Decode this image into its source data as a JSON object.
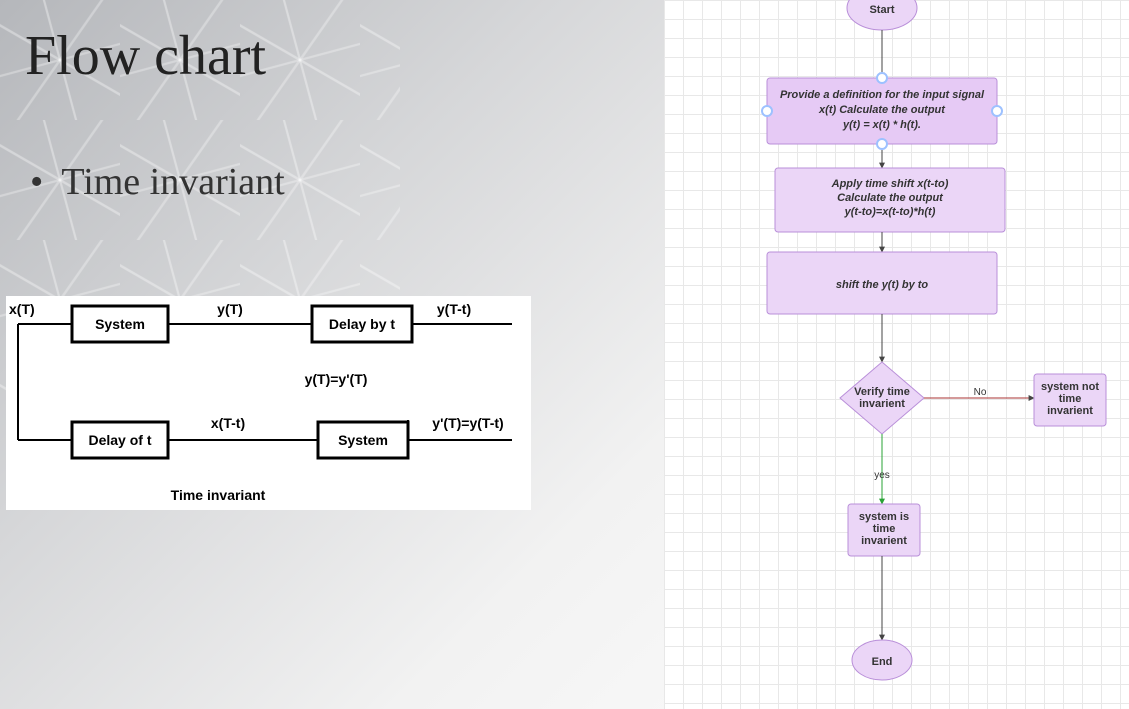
{
  "title": "Flow chart",
  "bullet": "Time invariant",
  "block_diagram": {
    "top_in": "x(T)",
    "box_system_top": "System",
    "top_mid": "y(T)",
    "box_delay_top": "Delay by t",
    "top_out": "y(T-t)",
    "equality": "y(T)=y'(T)",
    "box_delay_bottom": "Delay of t",
    "bottom_mid": "x(T-t)",
    "box_system_bottom": "System",
    "bottom_out": "y'(T)=y(T-t)",
    "caption": "Time invariant"
  },
  "flowchart": {
    "start": "Start",
    "step1_line1": "Provide a definition for the input signal",
    "step1_line2": "x(t) Calculate the output",
    "step1_line3": "y(t) = x(t) * h(t).",
    "step2_line1": "Apply time shift x(t-to)",
    "step2_line2": "Calculate the output",
    "step2_line3": "y(t-to)=x(t-to)*h(t)",
    "step3": "shift the y(t) by to",
    "decision_line1": "Verify time",
    "decision_line2": "invarient",
    "edge_no": "No",
    "edge_yes": "yes",
    "no_result_line1": "system not",
    "no_result_line2": "time",
    "no_result_line3": "invarient",
    "yes_result_line1": "system is",
    "yes_result_line2": "time",
    "yes_result_line3": "invarient",
    "end": "End"
  },
  "colors": {
    "node_fill": "#ebd6f7",
    "node_selected": "#e6caf5",
    "node_stroke": "#b98fd9",
    "selection_handle": "#9dc1ff",
    "arrow_yes": "#2aa336"
  }
}
